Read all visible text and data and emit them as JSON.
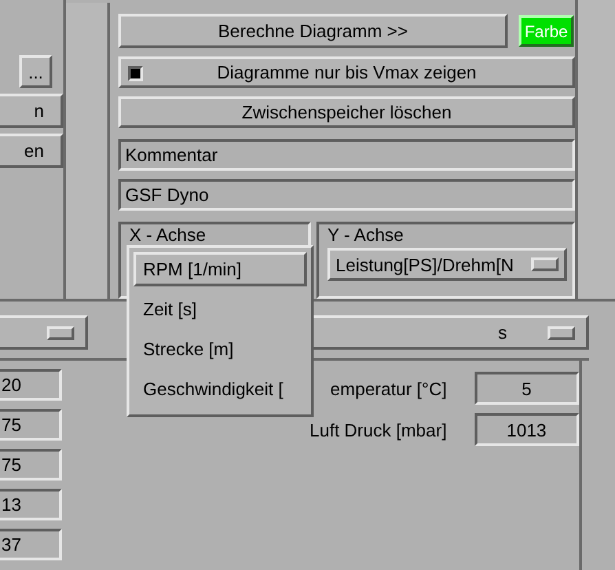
{
  "left_panel": {
    "browse_button": "...",
    "buttons": [
      "n",
      "en"
    ]
  },
  "calculate_button": "Berechne Diagramm >>",
  "color_button": "Farbe",
  "vmax_toggle": {
    "label": "Diagramme nur bis Vmax zeigen",
    "checked": true
  },
  "clear_button": "Zwischenspeicher löschen",
  "comment_field": {
    "value": "Kommentar"
  },
  "title_field": {
    "value": "GSF Dyno"
  },
  "x_axis": {
    "label": "X - Achse",
    "menu": [
      {
        "label": "RPM [1/min]",
        "selected": true
      },
      {
        "label": "Zeit [s]",
        "selected": false
      },
      {
        "label": "Strecke [m]",
        "selected": false
      },
      {
        "label": "Geschwindigkeit [",
        "selected": false
      }
    ]
  },
  "y_axis": {
    "label": "Y - Achse",
    "value": "Leistung[PS]/Drehm[N"
  },
  "lower_option_menu": {
    "value": "s"
  },
  "values_column": [
    "20",
    "75",
    "75",
    "13",
    "37"
  ],
  "conditions": [
    {
      "label": "emperatur [°C]",
      "value": "5"
    },
    {
      "label": "Luft Druck [mbar]",
      "value": "1013"
    }
  ]
}
